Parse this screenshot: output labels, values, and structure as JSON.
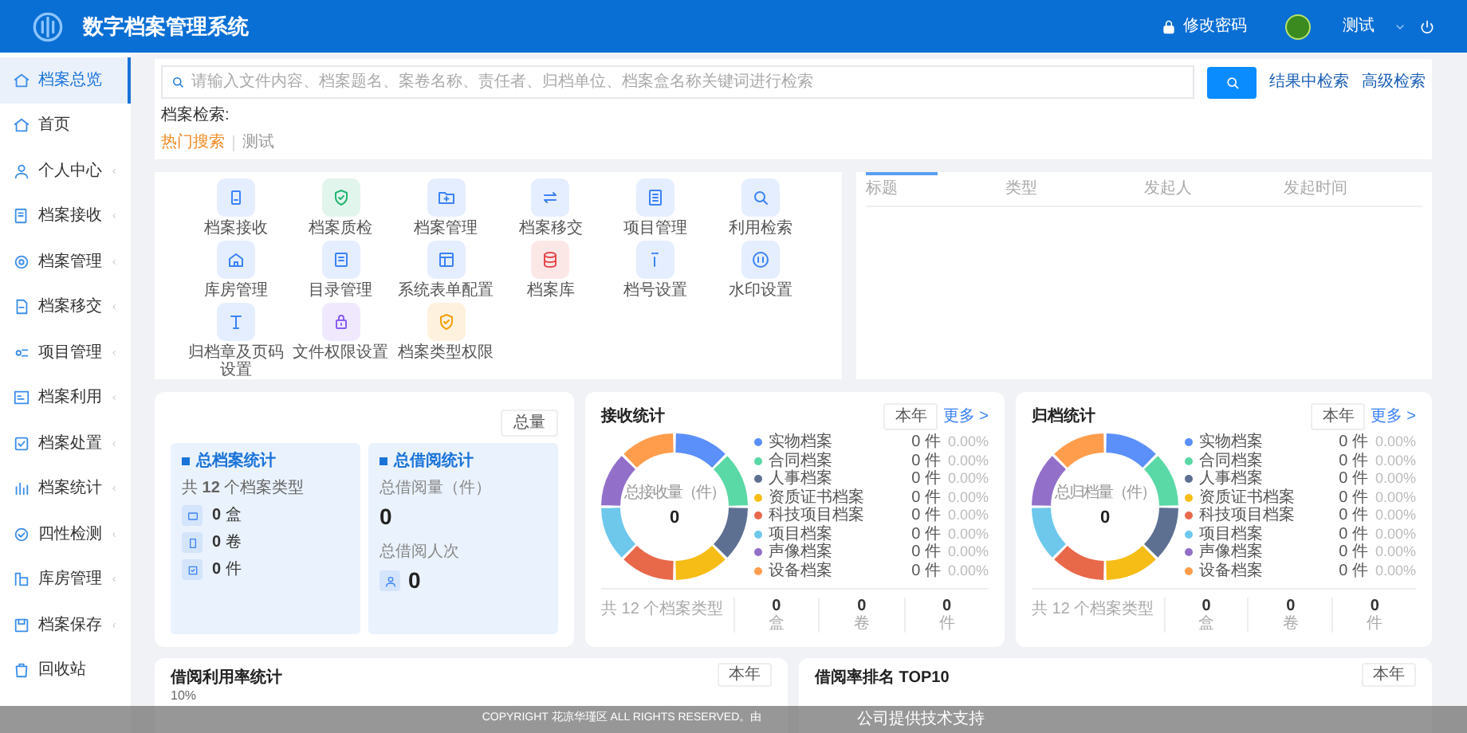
{
  "header": {
    "title": "数字档案管理系统",
    "change_password": "修改密码",
    "user": "测试"
  },
  "sidebar": {
    "items": [
      {
        "label": "档案总览",
        "selected": true,
        "has_children": false
      },
      {
        "label": "首页",
        "selected": false,
        "has_children": false
      },
      {
        "label": "个人中心",
        "selected": false,
        "has_children": true
      },
      {
        "label": "档案接收",
        "selected": false,
        "has_children": true
      },
      {
        "label": "档案管理",
        "selected": false,
        "has_children": true
      },
      {
        "label": "档案移交",
        "selected": false,
        "has_children": true
      },
      {
        "label": "项目管理",
        "selected": false,
        "has_children": true
      },
      {
        "label": "档案利用",
        "selected": false,
        "has_children": true
      },
      {
        "label": "档案处置",
        "selected": false,
        "has_children": true
      },
      {
        "label": "档案统计",
        "selected": false,
        "has_children": true
      },
      {
        "label": "四性检测",
        "selected": false,
        "has_children": true
      },
      {
        "label": "库房管理",
        "selected": false,
        "has_children": true
      },
      {
        "label": "档案保存",
        "selected": false,
        "has_children": true
      },
      {
        "label": "回收站",
        "selected": false,
        "has_children": false
      }
    ]
  },
  "search": {
    "placeholder": "请输入文件内容、档案题名、案卷名称、责任者、归档单位、档案盒名称关键词进行检索",
    "links": [
      "结果中检索",
      "高级检索"
    ],
    "label": "档案检索:",
    "hot_label": "热门搜索",
    "hot_terms": [
      "测试"
    ]
  },
  "shortcuts": [
    {
      "label": "档案接收",
      "color": "#3b82f6"
    },
    {
      "label": "档案质检",
      "color": "#22b573"
    },
    {
      "label": "档案管理",
      "color": "#3b82f6"
    },
    {
      "label": "档案移交",
      "color": "#3b82f6"
    },
    {
      "label": "项目管理",
      "color": "#3b82f6"
    },
    {
      "label": "利用检索",
      "color": "#3b82f6"
    },
    {
      "label": "库房管理",
      "color": "#3b82f6"
    },
    {
      "label": "目录管理",
      "color": "#3b82f6"
    },
    {
      "label": "系统表单配置",
      "color": "#3b82f6"
    },
    {
      "label": "档案库",
      "color": "#e5484d"
    },
    {
      "label": "档号设置",
      "color": "#3b82f6"
    },
    {
      "label": "水印设置",
      "color": "#3b82f6"
    },
    {
      "label": "归档章及页码设置",
      "color": "#3b82f6"
    },
    {
      "label": "文件权限设置",
      "color": "#8b5cf6"
    },
    {
      "label": "档案类型权限",
      "color": "#f59e0b"
    }
  ],
  "task_table": {
    "columns": [
      "标题",
      "类型",
      "发起人",
      "发起时间"
    ]
  },
  "overview_card": {
    "period": "总量",
    "archive": {
      "title": "总档案统计",
      "summary": "共 **12** 个档案类型",
      "rows": [
        "**0** 盒",
        "**0** 卷",
        "**0** 件"
      ]
    },
    "borrow": {
      "title": "总借阅统计",
      "count_label": "总借阅量（件）",
      "count": "0",
      "people_label": "总借阅人次",
      "people": "0"
    }
  },
  "stat_cards": [
    {
      "title": "接收统计",
      "period": "本年",
      "more": "更多 >",
      "center_label": "总接收量（件）",
      "center_value": "0",
      "legend": [
        {
          "name": "实物档案",
          "color": "#5b8ff9",
          "count": "0 件",
          "percent": "0.00%"
        },
        {
          "name": "合同档案",
          "color": "#5ad8a6",
          "count": "0 件",
          "percent": "0.00%"
        },
        {
          "name": "人事档案",
          "color": "#5d7092",
          "count": "0 件",
          "percent": "0.00%"
        },
        {
          "name": "资质证书档案",
          "color": "#f6bd16",
          "count": "0 件",
          "percent": "0.00%"
        },
        {
          "name": "科技项目档案",
          "color": "#e8684a",
          "count": "0 件",
          "percent": "0.00%"
        },
        {
          "name": "项目档案",
          "color": "#6dc8ec",
          "count": "0 件",
          "percent": "0.00%"
        },
        {
          "name": "声像档案",
          "color": "#9270ca",
          "count": "0 件",
          "percent": "0.00%"
        },
        {
          "name": "设备档案",
          "color": "#ff9d4d",
          "count": "0 件",
          "percent": "0.00%"
        }
      ],
      "footer": {
        "summary": "共 12 个档案类型",
        "totals": [
          {
            "value": "0",
            "unit": "盒"
          },
          {
            "value": "0",
            "unit": "卷"
          },
          {
            "value": "0",
            "unit": "件"
          }
        ]
      }
    },
    {
      "title": "归档统计",
      "period": "本年",
      "more": "更多 >",
      "center_label": "总归档量（件）",
      "center_value": "0",
      "legend": [
        {
          "name": "实物档案",
          "color": "#5b8ff9",
          "count": "0 件",
          "percent": "0.00%"
        },
        {
          "name": "合同档案",
          "color": "#5ad8a6",
          "count": "0 件",
          "percent": "0.00%"
        },
        {
          "name": "人事档案",
          "color": "#5d7092",
          "count": "0 件",
          "percent": "0.00%"
        },
        {
          "name": "资质证书档案",
          "color": "#f6bd16",
          "count": "0 件",
          "percent": "0.00%"
        },
        {
          "name": "科技项目档案",
          "color": "#e8684a",
          "count": "0 件",
          "percent": "0.00%"
        },
        {
          "name": "项目档案",
          "color": "#6dc8ec",
          "count": "0 件",
          "percent": "0.00%"
        },
        {
          "name": "声像档案",
          "color": "#9270ca",
          "count": "0 件",
          "percent": "0.00%"
        },
        {
          "name": "设备档案",
          "color": "#ff9d4d",
          "count": "0 件",
          "percent": "0.00%"
        }
      ],
      "footer": {
        "summary": "共 12 个档案类型",
        "totals": [
          {
            "value": "0",
            "unit": "盒"
          },
          {
            "value": "0",
            "unit": "卷"
          },
          {
            "value": "0",
            "unit": "件"
          }
        ]
      }
    }
  ],
  "bottom_cards": [
    {
      "title": "借阅利用率统计",
      "period": "本年",
      "axis_label": "10%"
    },
    {
      "title": "借阅率排名 TOP10",
      "period": "本年"
    }
  ],
  "footer": {
    "copyright": "COPYRIGHT 花凉华瑾区 ALL RIGHTS RESERVED。由",
    "support": "公司提供技术支持"
  }
}
